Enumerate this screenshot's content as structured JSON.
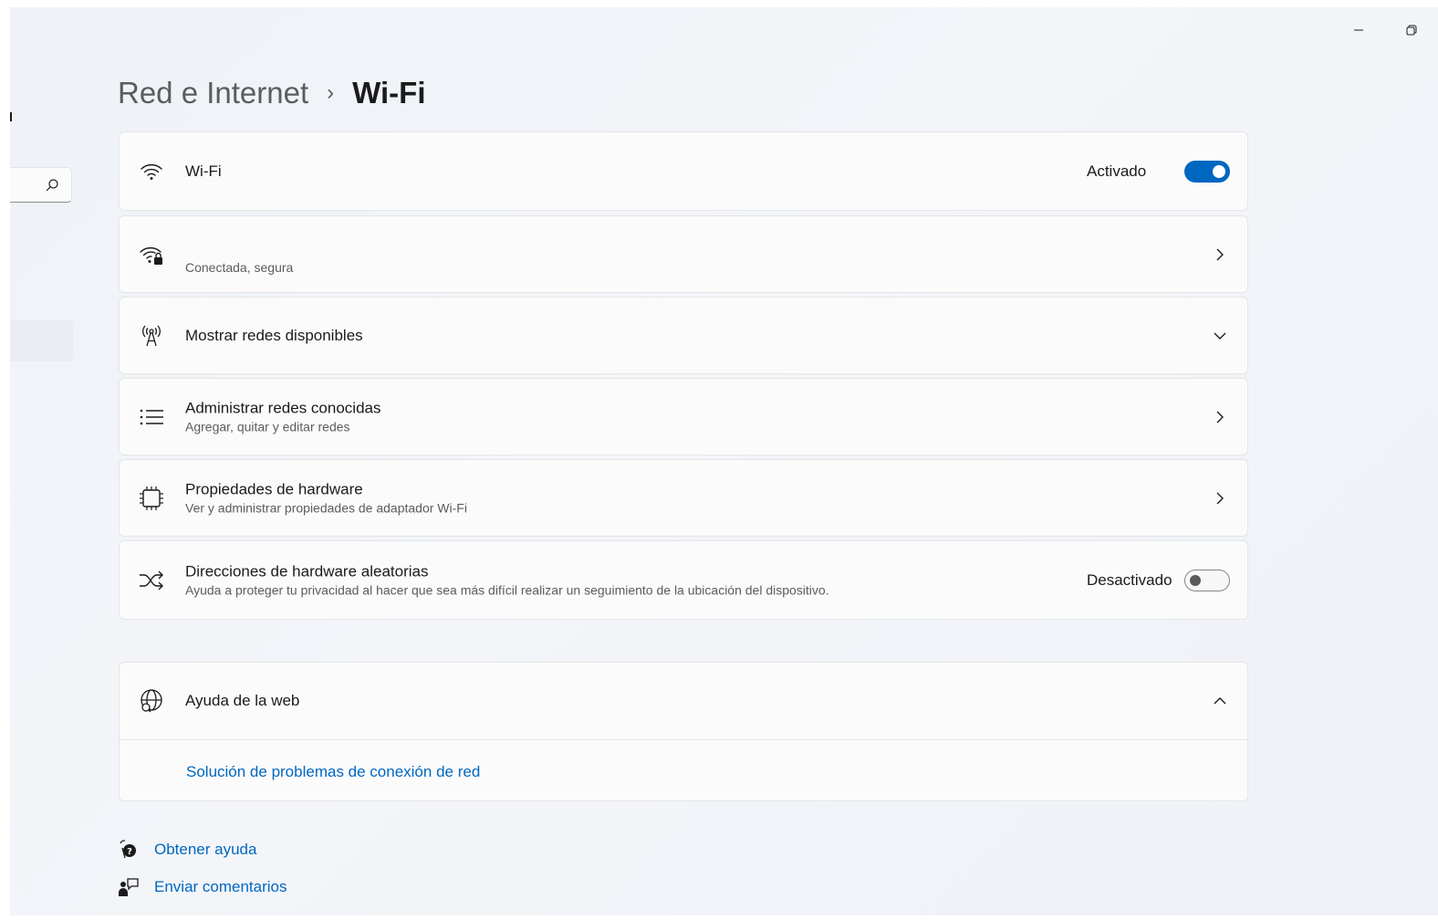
{
  "window": {
    "minimize_glyph": "—",
    "restore_glyph": "❐"
  },
  "breadcrumb": {
    "parent": "Red e Internet",
    "separator": "›",
    "current": "Wi-Fi"
  },
  "rows": {
    "wifi": {
      "icon": "wifi-icon",
      "title": "Wi-Fi",
      "state": "Activado",
      "toggle_on": true
    },
    "connection": {
      "icon": "wifi-secure-icon",
      "title": "",
      "subtitle": "Conectada, segura"
    },
    "available": {
      "icon": "antenna-icon",
      "title": "Mostrar redes disponibles"
    },
    "known": {
      "icon": "list-icon",
      "title": "Administrar redes conocidas",
      "subtitle": "Agregar, quitar y editar redes"
    },
    "hardware": {
      "icon": "chip-icon",
      "title": "Propiedades de hardware",
      "subtitle": "Ver y administrar propiedades de adaptador Wi-Fi"
    },
    "random": {
      "icon": "shuffle-icon",
      "title": "Direcciones de hardware aleatorias",
      "subtitle": "Ayuda a proteger tu privacidad al hacer que sea más difícil realizar un seguimiento de la ubicación del dispositivo.",
      "state": "Desactivado",
      "toggle_on": false
    }
  },
  "web_help": {
    "icon": "globe-icon",
    "title": "Ayuda de la web",
    "link": "Solución de problemas de conexión de red",
    "expanded": true
  },
  "footer": {
    "get_help": "Obtener ayuda",
    "feedback": "Enviar comentarios"
  },
  "colors": {
    "accent": "#0067c0",
    "card": "#fbfbfc",
    "text_secondary": "#5c5c5c"
  }
}
